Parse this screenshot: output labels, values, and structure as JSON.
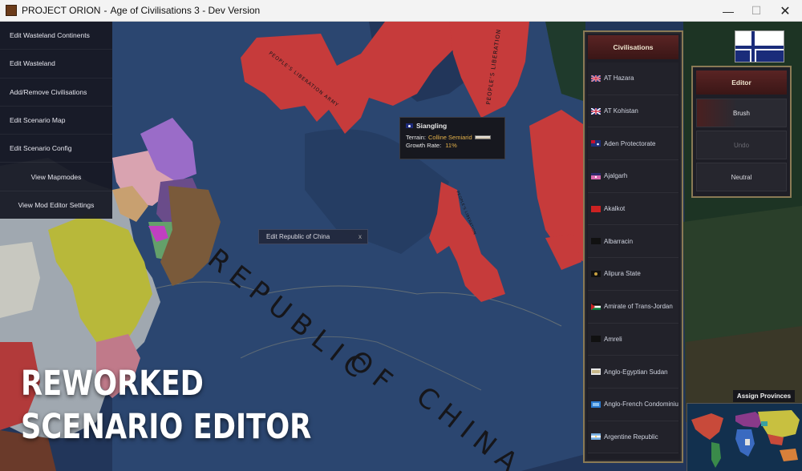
{
  "window": {
    "title": "PROJECT ORION",
    "subtitle": "Age of Civilisations 3 - Dev Version",
    "separator": "-",
    "min_glyph": "—",
    "max_glyph": "☐",
    "close_glyph": "✕"
  },
  "left_menu": {
    "items": [
      {
        "label": "Edit Wasteland Continents"
      },
      {
        "label": "Edit Wasteland"
      },
      {
        "label": "Add/Remove Civilisations"
      },
      {
        "label": "Edit Scenario Map"
      },
      {
        "label": "Edit Scenario Config"
      },
      {
        "label": "View Mapmodes"
      },
      {
        "label": "View Mod Editor Settings"
      }
    ]
  },
  "tooltip": {
    "province": "Siangling",
    "terrain_label": "Terrain:",
    "terrain_value": "Colline Semiarid",
    "growth_label": "Growth Rate:",
    "growth_value": "11%"
  },
  "edit_country": {
    "label": "Edit Republic of China",
    "close": "x"
  },
  "map_labels": {
    "main_country_1": "REPUBLIC",
    "main_country_2": "OF",
    "main_country_3": "CHINA",
    "pla_1": "PEOPLE'S LIBERATION ARMY",
    "pla_2": "PEOPLE'S LIBERATION",
    "pla_3": "PEOPLE'S LIBERATION"
  },
  "civ_panel": {
    "title": "Civilisations",
    "items": [
      {
        "name": "AT Hazara",
        "flag": "uk"
      },
      {
        "name": "AT Kohistan",
        "flag": "uk"
      },
      {
        "name": "Aden Protectorate",
        "flag": "blue-ensign"
      },
      {
        "name": "Ajalgarh",
        "flag": "pink-star"
      },
      {
        "name": "Akalkot",
        "flag": "red"
      },
      {
        "name": "Albarracin",
        "flag": "black"
      },
      {
        "name": "Alipura State",
        "flag": "black-emblem"
      },
      {
        "name": "Amirate of Trans-Jordan",
        "flag": "jordan"
      },
      {
        "name": "Amreli",
        "flag": "black"
      },
      {
        "name": "Anglo-Egyptian Sudan",
        "flag": "sudan"
      },
      {
        "name": "Anglo-French Condominium",
        "flag": "blue-light"
      },
      {
        "name": "Argentine Republic",
        "flag": "argentina"
      }
    ]
  },
  "editor_panel": {
    "title": "Editor",
    "brush": "Brush",
    "undo": "Undo",
    "neutral": "Neutral"
  },
  "minimap": {
    "label": "Assign Provinces"
  },
  "promo": {
    "line1": "REWORKED",
    "line2": "SCENARIO EDITOR"
  },
  "colors": {
    "sea": "#23375a",
    "roc_land": "#2c4670",
    "pla_red": "#c83a3a",
    "panel_border": "#8a7a55",
    "panel_header": "#4a1e1e",
    "tooltip_accent": "#e5b24a"
  }
}
